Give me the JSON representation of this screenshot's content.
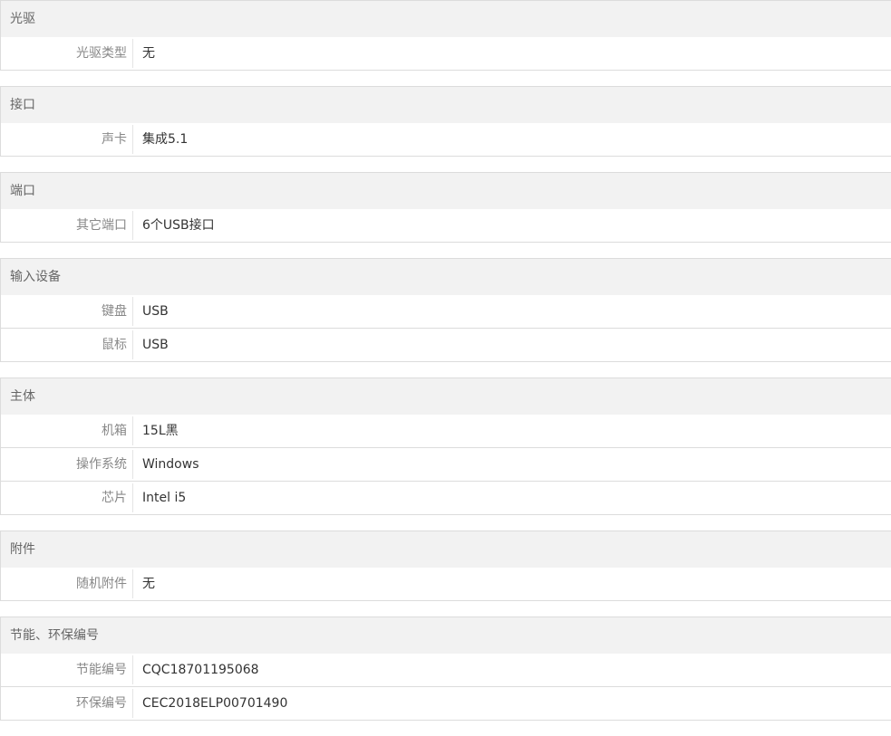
{
  "sections": [
    {
      "title": "光驱",
      "rows": [
        {
          "key": "光驱类型",
          "value": "无"
        }
      ]
    },
    {
      "title": "接口",
      "rows": [
        {
          "key": "声卡",
          "value": "集成5.1"
        }
      ]
    },
    {
      "title": "端口",
      "rows": [
        {
          "key": "其它端口",
          "value": "6个USB接口"
        }
      ]
    },
    {
      "title": "输入设备",
      "rows": [
        {
          "key": "键盘",
          "value": "USB"
        },
        {
          "key": "鼠标",
          "value": "USB"
        }
      ]
    },
    {
      "title": "主体",
      "rows": [
        {
          "key": "机箱",
          "value": "15L黑"
        },
        {
          "key": "操作系统",
          "value": "Windows"
        },
        {
          "key": "芯片",
          "value": "Intel i5"
        }
      ]
    },
    {
      "title": "附件",
      "rows": [
        {
          "key": "随机附件",
          "value": "无"
        }
      ]
    },
    {
      "title": "节能、环保编号",
      "rows": [
        {
          "key": "节能编号",
          "value": "CQC18701195068"
        },
        {
          "key": "环保编号",
          "value": "CEC2018ELP00701490"
        }
      ]
    }
  ]
}
